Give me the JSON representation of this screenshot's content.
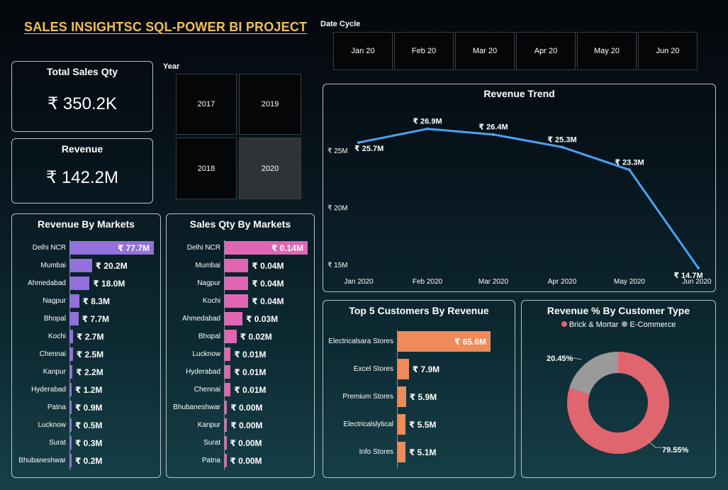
{
  "title": "SALES INSIGHTSC SQL-POWER BI PROJECT",
  "date_cycle": {
    "label": "Date Cycle",
    "items": [
      "Jan 20",
      "Feb 20",
      "Mar 20",
      "Apr 20",
      "May 20",
      "Jun 20"
    ]
  },
  "year_filter": {
    "label": "Year",
    "items": [
      "2017",
      "2019",
      "2018",
      "2020"
    ],
    "selected": "2020"
  },
  "kpis": {
    "total_sales_qty": {
      "label": "Total Sales Qty",
      "value": "₹ 350.2K"
    },
    "revenue": {
      "label": "Revenue",
      "value": "₹ 142.2M"
    }
  },
  "colors": {
    "title": "#f2c14e",
    "revenue_markets_bar": "#9370db",
    "sales_qty_markets_bar": "#e066b4",
    "customers_bar": "#ef8a5a",
    "trend_line": "#4aa3f5",
    "brick_mortar": "#e0656f",
    "e_commerce": "#9a9a9a"
  },
  "chart_data": [
    {
      "id": "revenue_by_markets",
      "type": "bar",
      "title": "Revenue By Markets",
      "categories": [
        "Delhi NCR",
        "Mumbai",
        "Ahmedabad",
        "Nagpur",
        "Bhopal",
        "Kochi",
        "Chennai",
        "Kanpur",
        "Hyderabad",
        "Patna",
        "Lucknow",
        "Surat",
        "Bhubaneshwar"
      ],
      "values": [
        77.7,
        20.2,
        18.0,
        8.3,
        7.7,
        2.7,
        2.5,
        2.2,
        1.2,
        0.9,
        0.5,
        0.3,
        0.2
      ],
      "labels": [
        "₹ 77.7M",
        "₹ 20.2M",
        "₹ 18.0M",
        "₹ 8.3M",
        "₹ 7.7M",
        "₹ 2.7M",
        "₹ 2.5M",
        "₹ 2.2M",
        "₹ 1.2M",
        "₹ 0.9M",
        "₹ 0.5M",
        "₹ 0.3M",
        "₹ 0.2M"
      ]
    },
    {
      "id": "sales_qty_by_markets",
      "type": "bar",
      "title": "Sales Qty By Markets",
      "categories": [
        "Delhi NCR",
        "Mumbai",
        "Nagpur",
        "Kochi",
        "Ahmedabad",
        "Bhopal",
        "Lucknow",
        "Hyderabad",
        "Chennai",
        "Bhubaneshwar",
        "Kanpur",
        "Surat",
        "Patna"
      ],
      "values": [
        0.14,
        0.04,
        0.04,
        0.04,
        0.03,
        0.02,
        0.01,
        0.01,
        0.01,
        0.004,
        0.004,
        0.003,
        0.003
      ],
      "labels": [
        "₹ 0.14M",
        "₹ 0.04M",
        "₹ 0.04M",
        "₹ 0.04M",
        "₹ 0.03M",
        "₹ 0.02M",
        "₹ 0.01M",
        "₹ 0.01M",
        "₹ 0.01M",
        "₹ 0.00M",
        "₹ 0.00M",
        "₹ 0.00M",
        "₹ 0.00M"
      ]
    },
    {
      "id": "revenue_trend",
      "type": "line",
      "title": "Revenue Trend",
      "x": [
        "Jan 2020",
        "Feb 2020",
        "Mar 2020",
        "Apr 2020",
        "May 2020",
        "Jun 2020"
      ],
      "y": [
        25.7,
        26.9,
        26.4,
        25.3,
        23.3,
        14.7
      ],
      "labels": [
        "₹ 25.7M",
        "₹ 26.9M",
        "₹ 26.4M",
        "₹ 25.3M",
        "₹ 23.3M",
        "₹ 14.7M"
      ],
      "yticks": [
        "₹ 25M",
        "₹ 20M",
        "₹ 15M"
      ],
      "ytick_values": [
        25,
        20,
        15
      ],
      "ylim": [
        14,
        28.5
      ]
    },
    {
      "id": "top5_customers",
      "type": "bar",
      "title": "Top 5 Customers By Revenue",
      "categories": [
        "Electricalsara Stores",
        "Excel Stores",
        "Premium Stores",
        "Electricalslytical",
        "Info Stores"
      ],
      "values": [
        65.6,
        7.9,
        5.9,
        5.5,
        5.1
      ],
      "labels": [
        "₹ 65.6M",
        "₹ 7.9M",
        "₹ 5.9M",
        "₹ 5.5M",
        "₹ 5.1M"
      ]
    },
    {
      "id": "revenue_pct_customer_type",
      "type": "pie",
      "title": "Revenue % By Customer Type",
      "legend": [
        "Brick & Mortar",
        "E-Commerce"
      ],
      "values": [
        79.55,
        20.45
      ],
      "labels": [
        "79.55%",
        "20.45%"
      ],
      "legend_position": "top"
    }
  ]
}
